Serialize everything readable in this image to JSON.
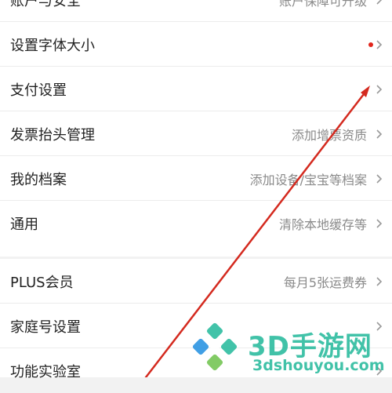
{
  "group1": [
    {
      "label": "账户与安全",
      "value": "账户保障可升级",
      "dot": false
    },
    {
      "label": "设置字体大小",
      "value": "",
      "dot": true
    },
    {
      "label": "支付设置",
      "value": "",
      "dot": false
    },
    {
      "label": "发票抬头管理",
      "value": "添加增票资质",
      "dot": false
    },
    {
      "label": "我的档案",
      "value": "添加设备/宝宝等档案",
      "dot": false
    },
    {
      "label": "通用",
      "value": "清除本地缓存等",
      "dot": false
    }
  ],
  "group2": [
    {
      "label": "PLUS会员",
      "value": "每月5张运费券",
      "dot": false
    },
    {
      "label": "家庭号设置",
      "value": "",
      "dot": false
    },
    {
      "label": "功能实验室",
      "value": "",
      "dot": false
    }
  ],
  "watermark": {
    "title": "3D手游网",
    "url": "3dshouyou.com"
  },
  "colors": {
    "accent_red": "#e1251b",
    "arrow_red": "#d42a1f",
    "watermark_green": "#21b89a"
  }
}
